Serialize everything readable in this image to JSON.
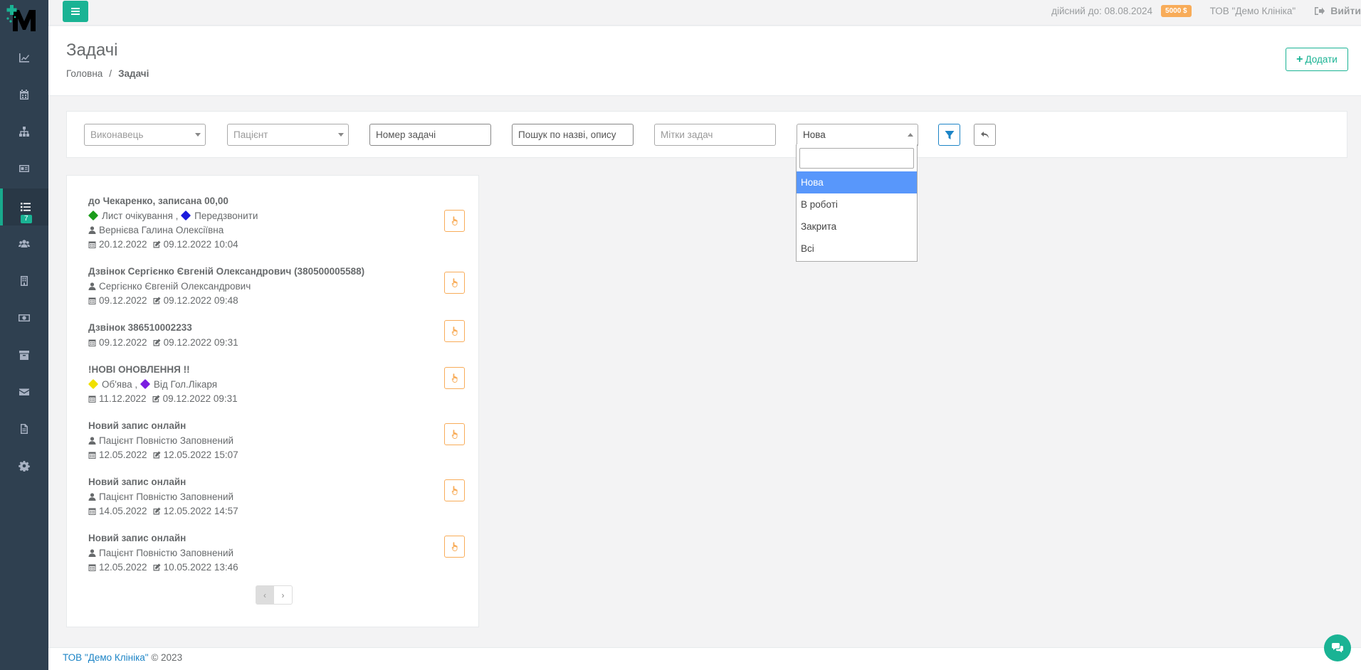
{
  "topbar": {
    "valid_until": "дійсний до: 08.08.2024",
    "balance": "5000 $",
    "clinic": "ТОВ \"Демо Клініка\"",
    "logout": "Вийти"
  },
  "sidebar": {
    "items": [
      {
        "icon": "chart-icon"
      },
      {
        "icon": "calendar-icon"
      },
      {
        "icon": "sitemap-icon"
      },
      {
        "icon": "id-card-icon"
      },
      {
        "icon": "tasks-list-icon",
        "badge": "7",
        "active": true
      },
      {
        "icon": "users-icon"
      },
      {
        "icon": "building-icon"
      },
      {
        "icon": "money-icon"
      },
      {
        "icon": "archive-icon"
      },
      {
        "icon": "envelope-icon"
      },
      {
        "icon": "file-icon"
      },
      {
        "icon": "settings-icon"
      }
    ]
  },
  "heading": {
    "title": "Задачі",
    "breadcrumb_home": "Головна",
    "breadcrumb_sep": "/",
    "breadcrumb_current": "Задачі",
    "add_label": "Додати"
  },
  "filters": {
    "executor_placeholder": "Виконавець",
    "patient_placeholder": "Пацієнт",
    "task_number_placeholder": "Номер задачі",
    "search_placeholder": "Пошук по назві, опису",
    "tags_placeholder": "Мітки задач",
    "status_value": "Нова",
    "status_options": [
      "Нова",
      "В роботі",
      "Закрита",
      "Всі"
    ]
  },
  "tasks": [
    {
      "title": "до Чекаренко, записана 00,00",
      "tags": [
        {
          "label": "Лист очікування",
          "color": "#1a9c1a"
        },
        {
          "label": "Передзвонити",
          "color": "#1a1adc"
        }
      ],
      "person": "Вернієва Галина Олексіївна",
      "due": "20.12.2022",
      "edited": "09.12.2022 10:04"
    },
    {
      "title": "Дзвінок Сергієнко Євгеній Олександрович (380500005588)",
      "tags": [],
      "person": "Сергієнко Євгеній Олександрович",
      "due": "09.12.2022",
      "edited": "09.12.2022 09:48"
    },
    {
      "title": "Дзвінок 386510002233",
      "tags": [],
      "person": "",
      "due": "09.12.2022",
      "edited": "09.12.2022 09:31"
    },
    {
      "title": "!НОВІ ОНОВЛЕННЯ !!",
      "tags": [
        {
          "label": "Об'ява",
          "color": "#f0e000"
        },
        {
          "label": "Від Гол.Лікаря",
          "color": "#7a1ee0"
        }
      ],
      "person": "",
      "due": "11.12.2022",
      "edited": "09.12.2022 09:31"
    },
    {
      "title": "Новий запис онлайн",
      "tags": [],
      "person": "Пацієнт Повністю Заповнений",
      "due": "12.05.2022",
      "edited": "12.05.2022 15:07"
    },
    {
      "title": "Новий запис онлайн",
      "tags": [],
      "person": "Пацієнт Повністю Заповнений",
      "due": "14.05.2022",
      "edited": "12.05.2022 14:57"
    },
    {
      "title": "Новий запис онлайн",
      "tags": [],
      "person": "Пацієнт Повністю Заповнений",
      "due": "12.05.2022",
      "edited": "10.05.2022 13:46"
    }
  ],
  "pager": {
    "prev": "‹",
    "next": "›"
  },
  "footer": {
    "company": "ТОВ \"Демо Клініка\"",
    "copyright": "© 2023"
  },
  "colors": {
    "primary": "#1ab394",
    "warning": "#f8ac59",
    "info": "#1c84c6",
    "sidebar": "#2f4050",
    "selected_option": "#5897fb"
  }
}
